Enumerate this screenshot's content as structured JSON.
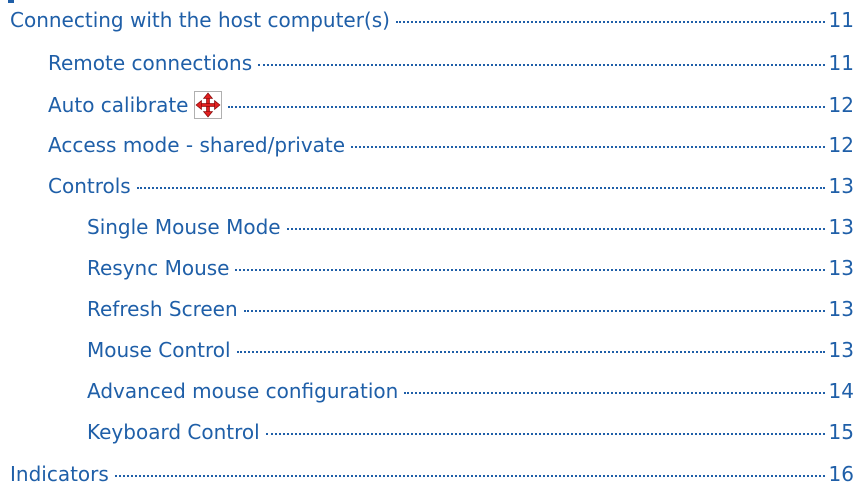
{
  "toc": {
    "entries": [
      {
        "title": "Connecting with the host computer(s)",
        "page": "11"
      },
      {
        "title": "Remote connections",
        "page": "11"
      },
      {
        "title": "Auto calibrate",
        "page": "12",
        "icon": "move-arrows-icon"
      },
      {
        "title": "Access mode - shared/private",
        "page": "12"
      },
      {
        "title": "Controls",
        "page": "13"
      },
      {
        "title": "Single Mouse Mode",
        "page": "13"
      },
      {
        "title": "Resync Mouse",
        "page": "13"
      },
      {
        "title": "Refresh Screen",
        "page": "13"
      },
      {
        "title": "Mouse Control",
        "page": "13"
      },
      {
        "title": "Advanced mouse configuration",
        "page": "14"
      },
      {
        "title": "Keyboard Control",
        "page": "15"
      },
      {
        "title": "Indicators",
        "page": "16"
      }
    ]
  },
  "colors": {
    "link": "#1f5fa8",
    "icon_arrows": "#e02020"
  }
}
